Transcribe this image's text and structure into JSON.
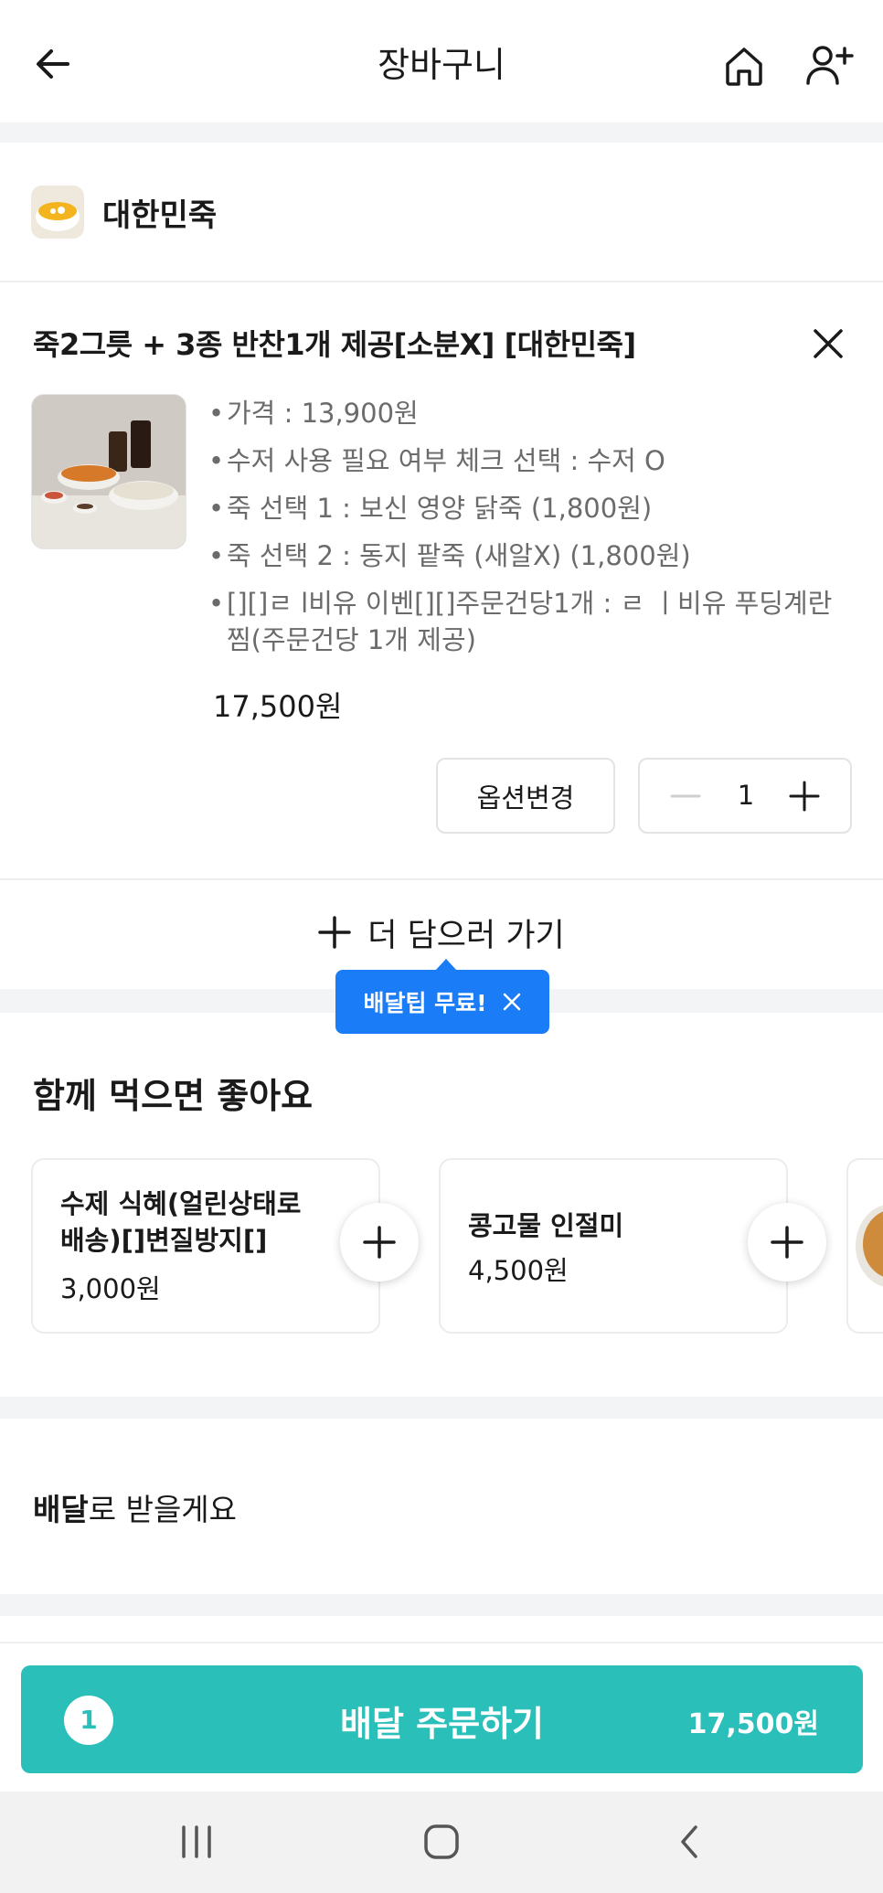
{
  "header": {
    "title": "장바구니",
    "back_icon": "arrow-left-icon",
    "home_icon": "home-icon",
    "share_icon": "user-plus-icon"
  },
  "store": {
    "name": "대한민죽"
  },
  "cart_item": {
    "title": "죽2그릇 + 3종 반찬1개 제공[소분X] [대한민죽]",
    "options": [
      "가격 : 13,900원",
      "수저 사용 필요 여부 체크 선택 : 수저 O",
      "죽 선택 1 : 보신 영양 닭죽 (1,800원)",
      "죽 선택 2 : 동지 팥죽 (새알X) (1,800원)",
      "[][]ㄹ l비유 이벤[][]주문건당1개 : ㄹ ㅣ비유 푸딩계란찜(주문건당 1개 제공)"
    ],
    "price": "17,500원",
    "change_option_label": "옵션변경",
    "quantity": "1"
  },
  "add_more": {
    "label": "더 담으러 가기",
    "tooltip": "배달팁 무료!"
  },
  "recommend": {
    "title": "함께 먹으면 좋아요",
    "items": [
      {
        "name": "수제 식혜(얼린상태로 배송)[]변질방지[]",
        "price": "3,000원"
      },
      {
        "name": "콩고물 인절미",
        "price": "4,500원"
      }
    ]
  },
  "delivery": {
    "bold": "배달",
    "rest": "로 받을게요"
  },
  "order": {
    "count": "1",
    "label": "배달 주문하기",
    "total": "17,500원"
  },
  "colors": {
    "accent": "#2bbfb9",
    "tooltip": "#1b7cf7"
  }
}
